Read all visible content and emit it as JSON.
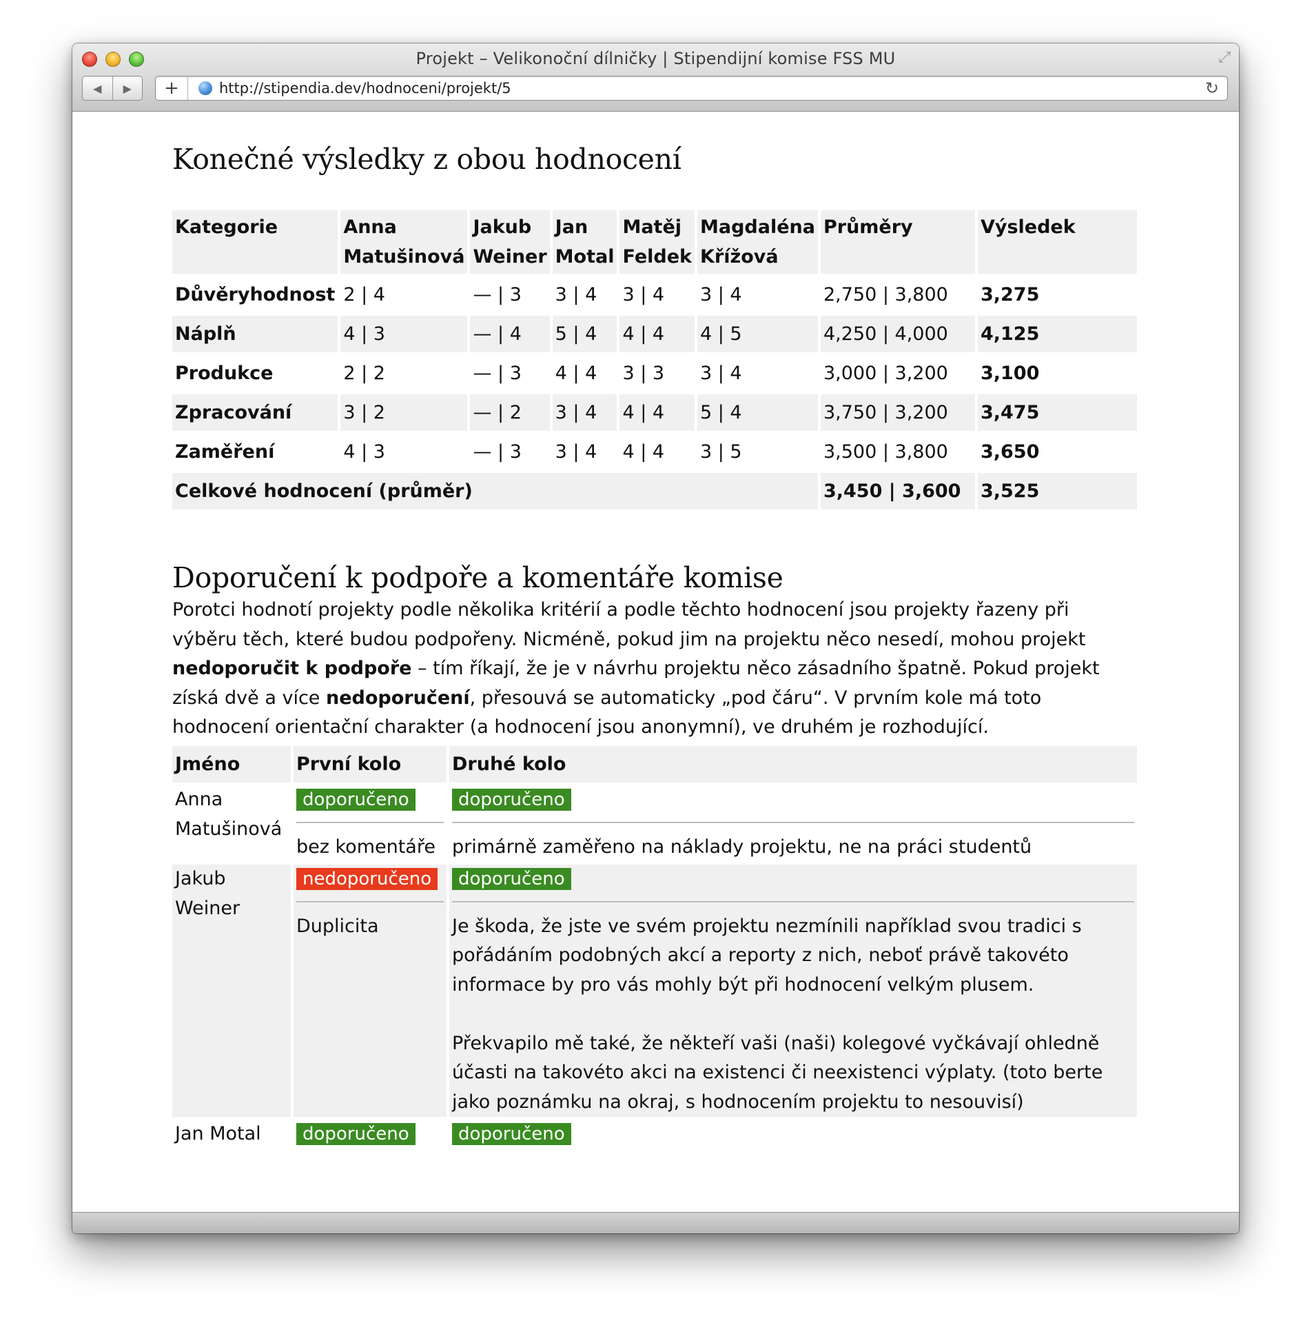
{
  "window": {
    "title": "Projekt – Velikonoční dílničky | Stipendijní komise FSS MU",
    "url": "http://stipendia.dev/hodnoceni/projekt/5",
    "icons": [
      "close-icon",
      "minimize-icon",
      "zoom-icon",
      "back-icon",
      "forward-icon",
      "plus-icon",
      "globe-icon",
      "reload-icon",
      "resize-icon"
    ]
  },
  "results": {
    "heading": "Konečné výsledky z obou hodnocení",
    "headers": [
      "Kategorie",
      "Anna Matušinová",
      "Jakub Weiner",
      "Jan Motal",
      "Matěj Feldek",
      "Magdaléna Křížová",
      "Průměry",
      "Výsledek"
    ],
    "rows": [
      {
        "category": "Důvěryhodnost",
        "scores": [
          "2 | 4",
          "— | 3",
          "3 | 4",
          "3 | 4",
          "3 | 4"
        ],
        "average": "2,750 | 3,800",
        "result": "3,275"
      },
      {
        "category": "Náplň",
        "scores": [
          "4 | 3",
          "— | 4",
          "5 | 4",
          "4 | 4",
          "4 | 5"
        ],
        "average": "4,250 | 4,000",
        "result": "4,125"
      },
      {
        "category": "Produkce",
        "scores": [
          "2 | 2",
          "— | 3",
          "4 | 4",
          "3 | 3",
          "3 | 4"
        ],
        "average": "3,000 | 3,200",
        "result": "3,100"
      },
      {
        "category": "Zpracování",
        "scores": [
          "3 | 2",
          "— | 2",
          "3 | 4",
          "4 | 4",
          "5 | 4"
        ],
        "average": "3,750 | 3,200",
        "result": "3,475"
      },
      {
        "category": "Zaměření",
        "scores": [
          "4 | 3",
          "— | 3",
          "3 | 4",
          "4 | 4",
          "3 | 5"
        ],
        "average": "3,500 | 3,800",
        "result": "3,650"
      }
    ],
    "total": {
      "label": "Celkové hodnocení (průměr)",
      "average": "3,450 | 3,600",
      "result": "3,525"
    }
  },
  "recommendations": {
    "heading": "Doporučení k podpoře a komentáře komise",
    "intro": {
      "part1": "Porotci hodnotí projekty podle několika kritérií a podle těchto hodnocení jsou projekty řazeny při výběru těch, které budou podpořeny. Nicméně, pokud jim na projektu něco nesedí, mohou projekt ",
      "bold1": "nedoporučit k podpoře",
      "part2": " – tím říkají, že je v návrhu projektu něco zásadního špatně. Pokud projekt získá dvě a více ",
      "bold2": "nedoporučení",
      "part3": ", přesouvá se automaticky „pod čáru“. V prvním kole má toto hodnocení orientační charakter (a hodnocení jsou anonymní), ve druhém je rozhodující."
    },
    "headers": [
      "Jméno",
      "První kolo",
      "Druhé kolo"
    ],
    "rows": [
      {
        "name": "Anna Matušinová",
        "round1": {
          "status": "doporučeno",
          "color": "#3a8b22",
          "comment": "bez komentáře"
        },
        "round2": {
          "status": "doporučeno",
          "color": "#3a8b22",
          "comment": [
            "primárně zaměřeno na náklady projektu, ne na práci studentů"
          ]
        }
      },
      {
        "name": "Jakub Weiner",
        "round1": {
          "status": "nedoporučeno",
          "color": "#e83a1c",
          "comment": "Duplicita"
        },
        "round2": {
          "status": "doporučeno",
          "color": "#3a8b22",
          "comment": [
            "Je škoda, že jste ve svém projektu nezmínili například svou tradici s pořádáním podobných akcí a reporty z nich, neboť právě takovéto informace by pro vás mohly být při hodnocení velkým plusem.",
            "Překvapilo mě také, že někteří vaši (naši) kolegové vyčkávají ohledně účasti na takovéto akci na existenci či neexistenci výplaty. (toto berte jako poznámku na okraj, s hodnocením projektu to nesouvisí)"
          ]
        }
      },
      {
        "name": "Jan Motal",
        "round1": {
          "status": "doporučeno",
          "color": "#3a8b22",
          "comment": ""
        },
        "round2": {
          "status": "doporučeno",
          "color": "#3a8b22",
          "comment": []
        }
      }
    ]
  }
}
